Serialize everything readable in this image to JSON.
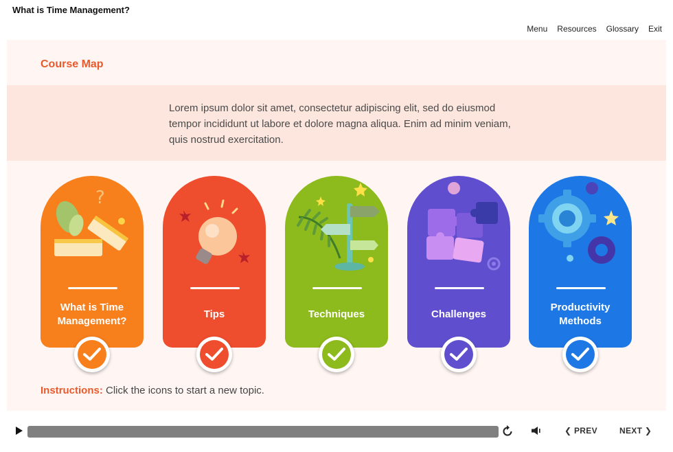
{
  "app": {
    "title": "What is Time Management?"
  },
  "nav": {
    "menu": "Menu",
    "resources": "Resources",
    "glossary": "Glossary",
    "exit": "Exit"
  },
  "slide": {
    "heading": "Course Map",
    "intro": "Lorem ipsum dolor sit amet, consectetur adipiscing elit, sed do eiusmod tempor incididunt ut labore et dolore magna aliqua. Enim ad minim veniam, quis nostrud exercitation.",
    "instructions_label": "Instructions:",
    "instructions_text": " Click the icons to start a new topic."
  },
  "topics": [
    {
      "label_line1": "What is Time",
      "label_line2": "Management?",
      "color": "#f77f1c",
      "icon": "books-plant-icon",
      "completed": true
    },
    {
      "label_line1": "Tips",
      "label_line2": "",
      "color": "#ee4d2e",
      "icon": "lightbulb-icon",
      "completed": true
    },
    {
      "label_line1": "Techniques",
      "label_line2": "",
      "color": "#8dba1c",
      "icon": "signpost-icon",
      "completed": true
    },
    {
      "label_line1": "Challenges",
      "label_line2": "",
      "color": "#5f4fcf",
      "icon": "puzzle-icon",
      "completed": true
    },
    {
      "label_line1": "Productivity",
      "label_line2": "Methods",
      "color": "#1d78e6",
      "icon": "gears-icon",
      "completed": true
    }
  ],
  "player": {
    "prev": "PREV",
    "next": "NEXT"
  }
}
